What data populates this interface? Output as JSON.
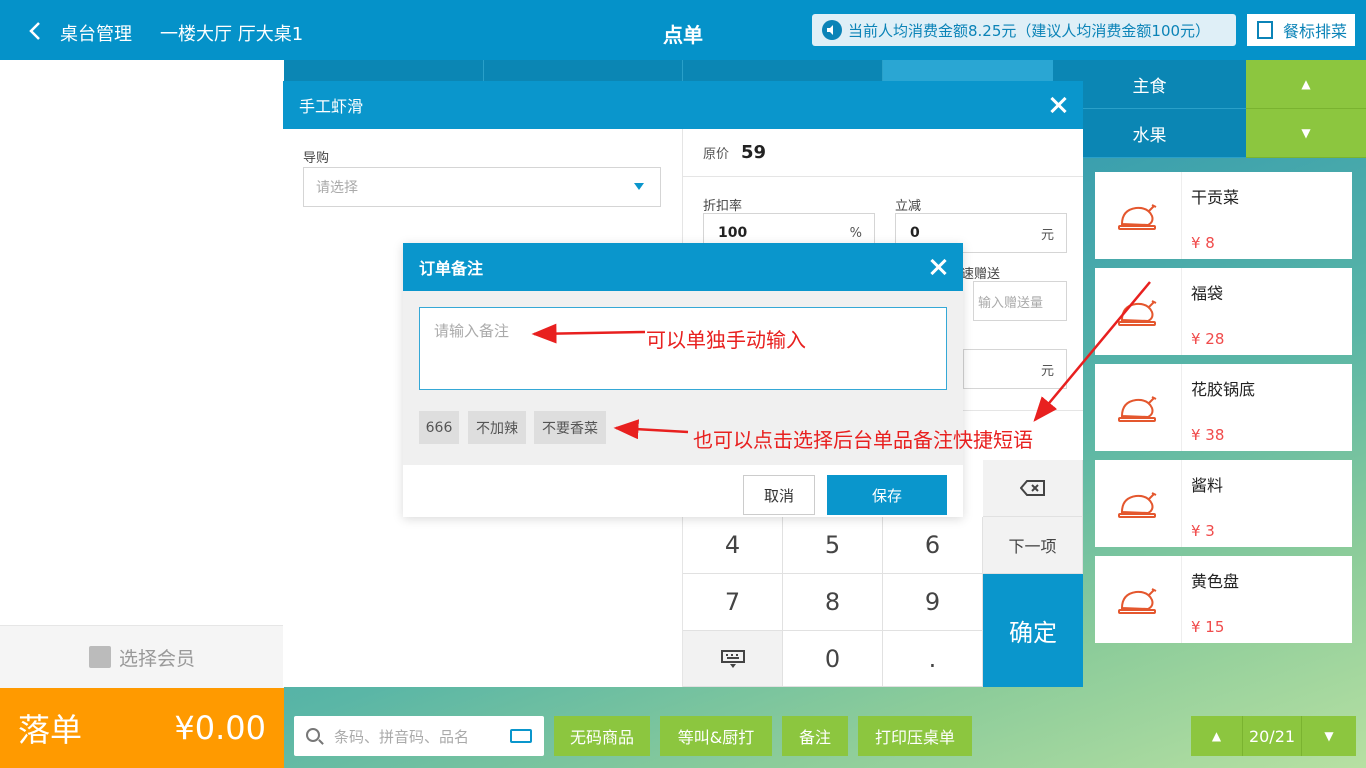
{
  "header": {
    "back_crumb": "桌台管理",
    "table_crumb": "一楼大厅 厅大桌1",
    "title": "点单",
    "notice": "当前人均消费金额8.25元（建议人均消费金额100元）",
    "rank_button": "餐标排菜"
  },
  "categories": {
    "right_items": [
      "主食",
      "水果"
    ]
  },
  "dishes": [
    {
      "name": "干贡菜",
      "price": "¥ 8"
    },
    {
      "name": "福袋",
      "price": "¥ 28"
    },
    {
      "name": "花胶锅底",
      "price": "¥ 38"
    },
    {
      "name": "酱料",
      "price": "¥ 3"
    },
    {
      "name": "黄色盘",
      "price": "¥ 15"
    }
  ],
  "left_panel": {
    "member_label": "选择会员",
    "order_label": "落单",
    "order_total": "¥0.00"
  },
  "dish_modal": {
    "title": "手工虾滑",
    "guide_label": "导购",
    "guide_placeholder": "请选择",
    "original_price_label": "原价",
    "original_price": "59",
    "discount_label": "折扣率",
    "discount_value": "100",
    "discount_unit": "%",
    "reduce_label": "立减",
    "reduce_value": "0",
    "reduce_unit": "元",
    "gift_label": "速赠送",
    "gift_placeholder": "输入赠送量",
    "price_unit": "元",
    "keypad": {
      "keys": [
        "4",
        "5",
        "6",
        "7",
        "8",
        "9",
        "0",
        "."
      ],
      "next": "下一项",
      "confirm": "确定"
    }
  },
  "remark_dialog": {
    "title": "订单备注",
    "placeholder": "请输入备注",
    "chips": [
      "666",
      "不加辣",
      "不要香菜"
    ],
    "cancel": "取消",
    "save": "保存"
  },
  "annotations": {
    "a1": "可以单独手动输入",
    "a2": "也可以点击选择后台单品备注快捷短语"
  },
  "bottom_bar": {
    "search_placeholder": "条码、拼音码、品名",
    "buttons": [
      "无码商品",
      "等叫&厨打",
      "备注",
      "打印压桌单"
    ],
    "page": "20/21"
  },
  "colors": {
    "primary": "#0a96cc",
    "green": "#8cc63f",
    "orange": "#ff9a00",
    "price_red": "#f04b4b",
    "annotation_red": "#e8201f"
  }
}
